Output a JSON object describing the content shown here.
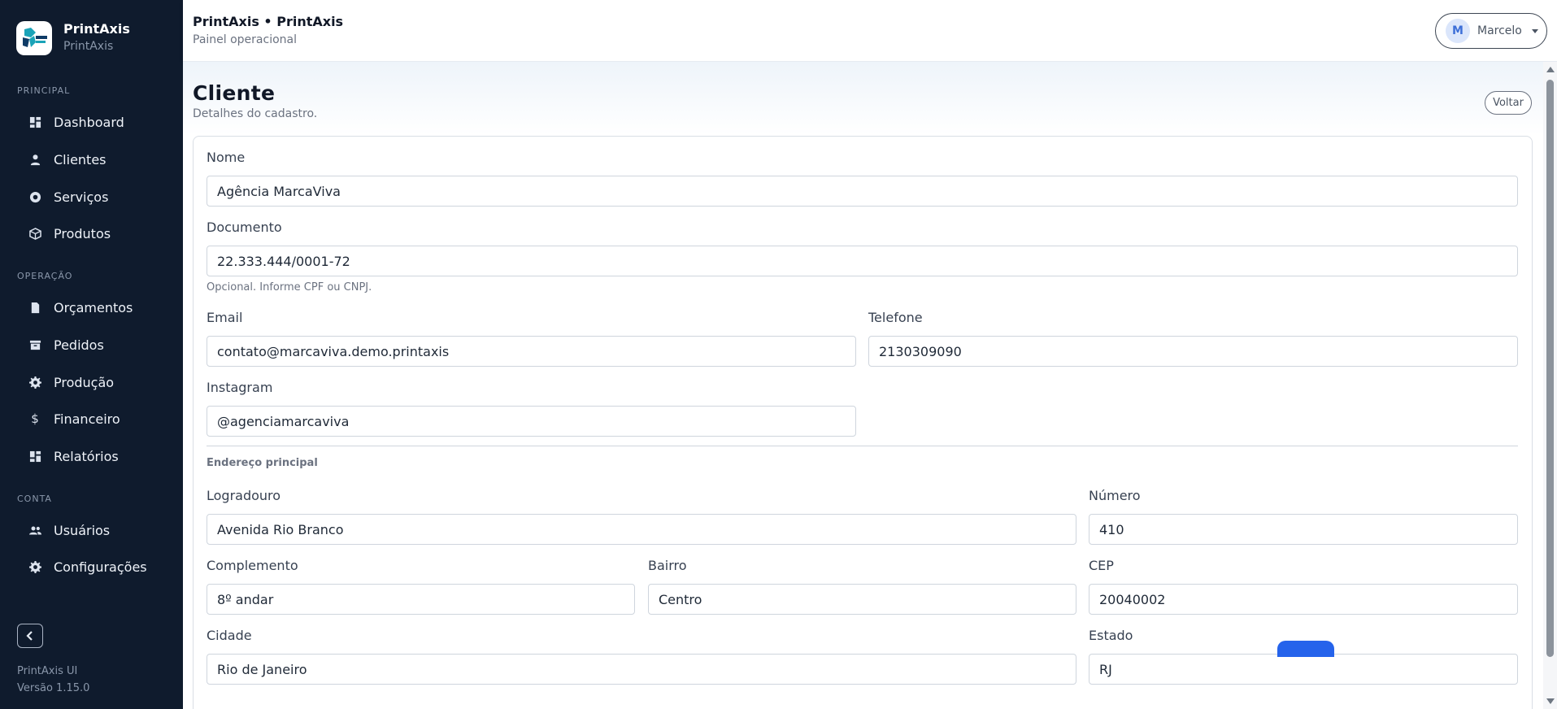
{
  "brand": {
    "name": "PrintAxis",
    "subtitle": "PrintAxis"
  },
  "sidebar": {
    "sections": [
      {
        "title": "PRINCIPAL"
      },
      {
        "title": "OPERAÇÃO"
      },
      {
        "title": "CONTA"
      }
    ],
    "items": [
      {
        "label": "Dashboard",
        "icon": "dashboard-icon"
      },
      {
        "label": "Clientes",
        "icon": "user-icon"
      },
      {
        "label": "Serviços",
        "icon": "service-icon"
      },
      {
        "label": "Produtos",
        "icon": "box-icon"
      },
      {
        "label": "Orçamentos",
        "icon": "document-icon"
      },
      {
        "label": "Pedidos",
        "icon": "archive-icon"
      },
      {
        "label": "Produção",
        "icon": "gear-icon"
      },
      {
        "label": "Financeiro",
        "icon": "dollar-icon"
      },
      {
        "label": "Relatórios",
        "icon": "grid-icon"
      },
      {
        "label": "Usuários",
        "icon": "users-icon"
      },
      {
        "label": "Configurações",
        "icon": "settings-icon"
      }
    ],
    "footer": {
      "app": "PrintAxis UI",
      "version": "Versão 1.15.0"
    }
  },
  "header": {
    "title": "PrintAxis • PrintAxis",
    "subtitle": "Painel operacional",
    "user": {
      "initial": "M",
      "name": "Marcelo"
    }
  },
  "page": {
    "title": "Cliente",
    "subtitle": "Detalhes do cadastro.",
    "back_label": "Voltar"
  },
  "form": {
    "nome": {
      "label": "Nome",
      "value": "Agência MarcaViva"
    },
    "documento": {
      "label": "Documento",
      "value": "22.333.444/0001-72",
      "help": "Opcional. Informe CPF ou CNPJ."
    },
    "email": {
      "label": "Email",
      "value": "contato@marcaviva.demo.printaxis"
    },
    "telefone": {
      "label": "Telefone",
      "value": "2130309090"
    },
    "instagram": {
      "label": "Instagram",
      "value": "@agenciamarcaviva"
    },
    "address_section": "Endereço principal",
    "logradouro": {
      "label": "Logradouro",
      "value": "Avenida Rio Branco"
    },
    "numero": {
      "label": "Número",
      "value": "410"
    },
    "complemento": {
      "label": "Complemento",
      "value": "8º andar"
    },
    "bairro": {
      "label": "Bairro",
      "value": "Centro"
    },
    "cep": {
      "label": "CEP",
      "value": "20040002"
    },
    "cidade": {
      "label": "Cidade",
      "value": "Rio de Janeiro"
    },
    "estado": {
      "label": "Estado",
      "value": "RJ"
    }
  },
  "colors": {
    "sidebar_bg": "#0f1b2d",
    "accent": "#2563eb"
  }
}
